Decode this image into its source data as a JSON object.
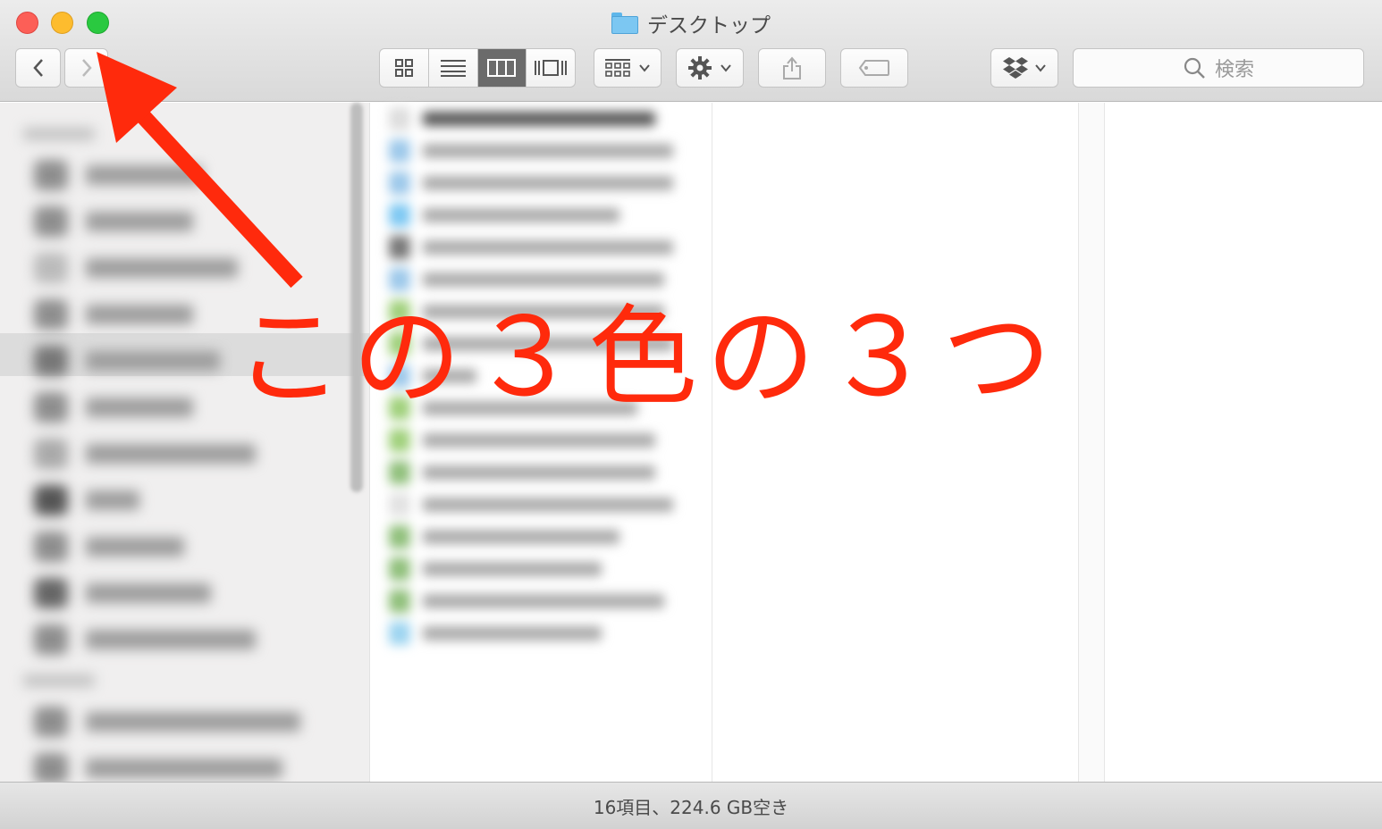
{
  "window": {
    "title": "デスクトップ",
    "folder_icon": "folder-icon"
  },
  "toolbar": {
    "back_icon": "chevron-left-icon",
    "forward_icon": "chevron-right-icon",
    "view_modes": [
      "icon-view",
      "list-view",
      "column-view",
      "cover-flow-view"
    ],
    "active_view": "column-view",
    "arrange_icon": "arrange-grid-icon",
    "action_icon": "gear-icon",
    "share_icon": "share-icon",
    "tag_icon": "tag-icon",
    "dropbox_icon": "dropbox-icon",
    "search_placeholder": "検索"
  },
  "status": {
    "text": "16項目、224.6 GB空き"
  },
  "annotation": {
    "text": "この３色の３つ",
    "color": "#ff2a0c"
  },
  "colors": {
    "close": "#fc5f57",
    "minimize": "#fdbc2e",
    "zoom": "#2ac940"
  }
}
